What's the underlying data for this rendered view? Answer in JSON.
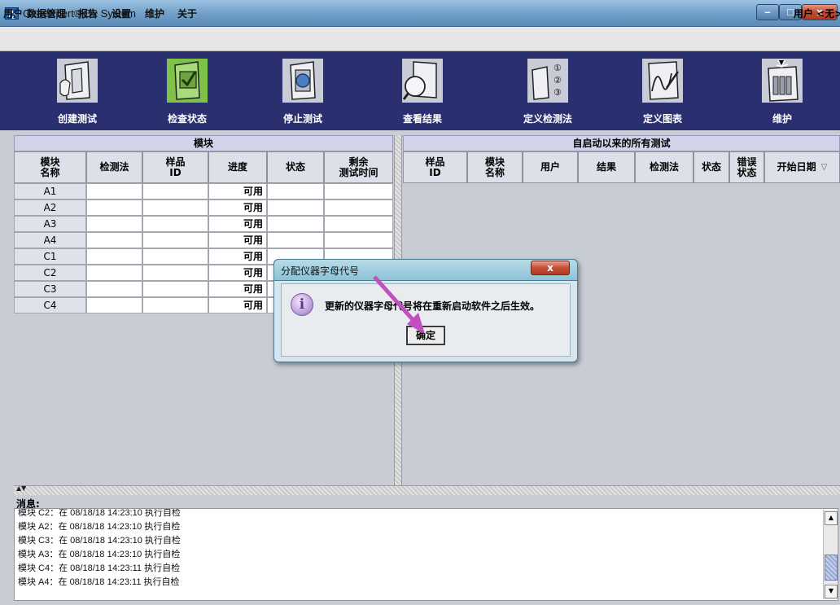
{
  "window": {
    "title": "GeneXpert® Dx System",
    "min": "–",
    "max": "□",
    "close": "x"
  },
  "menu": [
    "用户",
    "数据管理",
    "报告",
    "设置",
    "维护",
    "关于"
  ],
  "user_status": "用户 <无>",
  "toolbar": [
    {
      "label": "创建测试",
      "icon": "create-test-icon"
    },
    {
      "label": "检查状态",
      "icon": "check-status-icon"
    },
    {
      "label": "停止测试",
      "icon": "stop-test-icon"
    },
    {
      "label": "查看结果",
      "icon": "view-results-icon"
    },
    {
      "label": "定义检测法",
      "icon": "define-assay-icon",
      "steps": [
        "①",
        "②",
        "③"
      ]
    },
    {
      "label": "定义图表",
      "icon": "define-graph-icon"
    },
    {
      "label": "维护",
      "icon": "maintenance-icon"
    }
  ],
  "modules_panel": {
    "title": "模块",
    "columns": [
      "模块名称",
      "检测法",
      "样品 ID",
      "进度",
      "状态",
      "剩余测试时间"
    ],
    "rows": [
      {
        "module": "A1",
        "progress": "可用"
      },
      {
        "module": "A2",
        "progress": "可用"
      },
      {
        "module": "A3",
        "progress": "可用"
      },
      {
        "module": "A4",
        "progress": "可用"
      },
      {
        "module": "C1",
        "progress": "可用"
      },
      {
        "module": "C2",
        "progress": "可用"
      },
      {
        "module": "C3",
        "progress": "可用"
      },
      {
        "module": "C4",
        "progress": "可用"
      }
    ]
  },
  "tests_panel": {
    "title": "自启动以来的所有测试",
    "columns": [
      "样品 ID",
      "模块名称",
      "用户",
      "结果",
      "检测法",
      "状态",
      "错误状态",
      "开始日期"
    ],
    "sort_indicator": "▽"
  },
  "messages": {
    "title": "消息:",
    "lines": [
      "模块 C2：在 08/18/18 14:23:10 执行自检",
      "模块 A2：在 08/18/18 14:23:10 执行自检",
      "模块 C3：在 08/18/18 14:23:10 执行自检",
      "模块 A3：在 08/18/18 14:23:10 执行自检",
      "模块 C4：在 08/18/18 14:23:11 执行自检",
      "模块 A4：在 08/18/18 14:23:11 执行自检"
    ]
  },
  "dialog": {
    "title": "分配仪器字母代号",
    "message": "更新的仪器字母代号将在重新启动软件之后生效。",
    "ok_label": "确定",
    "close_label": "x"
  },
  "colors": {
    "toolbar_bg": "#2a2f70",
    "arrow": "#c04fbf",
    "panel_header": "#d2d2ea"
  }
}
